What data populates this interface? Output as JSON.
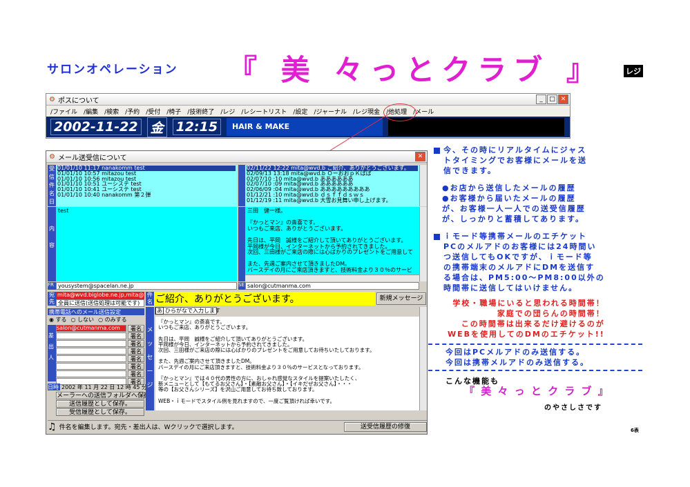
{
  "header": {
    "subtitle": "サロンオペレーション",
    "title": "『 美 々っとクラブ 』",
    "tag": "レジ"
  },
  "window_back": {
    "title": "ポスについて",
    "menu": [
      "/ファイル",
      "/編集",
      "/検索",
      "/予約",
      "/受付",
      "/椅子",
      "/技術終了",
      "/レジ",
      "/レシートリスト",
      "/設定",
      "/ジャーナル",
      "/レジ現金",
      "/他処理",
      "/メール"
    ],
    "date": "2002-11-22",
    "weekday": "金",
    "time": "12:15",
    "banner": "HAIR & MAKE"
  },
  "mail": {
    "title": "メール送受信について",
    "sent_labels": "受信件名日",
    "sent_list": [
      {
        "date": "01/01/10",
        "time": "11:17",
        "from": "nanakomm",
        "subject": "test",
        "selected": true
      },
      {
        "date": "01/01/10",
        "time": "10:57",
        "from": "mitazou",
        "subject": "test"
      },
      {
        "date": "01/01/10",
        "time": "10:56",
        "from": "mitazou",
        "subject": "test"
      },
      {
        "date": "01/01/10",
        "time": "10:51",
        "from": "ユーシステ",
        "subject": "test"
      },
      {
        "date": "01/01/10",
        "time": "10:41",
        "from": "ユーシステ",
        "subject": "test"
      },
      {
        "date": "01/01/10",
        "time": "10:40",
        "from": "nanakomm",
        "subject": "第２弾"
      }
    ],
    "recv_list": [
      {
        "date": "02/11/22",
        "time": "12:22",
        "from": "mita@wvd.b",
        "subject": "ご紹介、ありがとうございます。",
        "selected": true
      },
      {
        "date": "02/09/13",
        "time": "13:18",
        "from": "mita@wvd.b",
        "subject": "ＯーおおｐＫぱぱ"
      },
      {
        "date": "02/07/10",
        "time": ":10",
        "from": "mita@wvd.b",
        "subject": "ああああああ"
      },
      {
        "date": "02/07/10",
        "time": ":09",
        "from": "mita@wvd.b",
        "subject": "ああああああ"
      },
      {
        "date": "02/06/09",
        "time": ":04",
        "from": "mita@wvd.b",
        "subject": "あああああああああ"
      },
      {
        "date": "01/12/21",
        "time": ":10",
        "from": "mita@wvd.b",
        "subject": "ｄｓｆｆｄｓｗｓ"
      },
      {
        "date": "01/12/19",
        "time": ":11",
        "from": "mita@wvd.b",
        "subject": "大雪お見舞い申し上げます。"
      }
    ],
    "sent_body_label": "内容",
    "sent_body": "test",
    "recv_body": [
      "三田　健一様。",
      "",
      "『かっとマン』の斎喜です。",
      "いつもご来店、ありがとうございます。",
      "",
      "先日は、平岡　誠様をご紹介して頂いてありがとうございます。",
      "平岡様が今日、インターネットから予約されてきました。",
      "次回、三田様がご来店の際には心ばかりのプレゼントをご用意して",
      "",
      "また、先週ご案内させて頂きましたDM。",
      "バースデイの月にご来店頂きますと、技術料金より３０％のサービ"
    ],
    "from_label": "FR",
    "from_addr": "yousystem@spacelan.ne.jp",
    "to_label": "SE",
    "to_addr": "salon@cutmanma.com",
    "dest_label": "宛先",
    "dest_value": "mita@wvd.biglobe.ne.jp,mita@you",
    "bulk_note": "全員に送信(送信処理は可能です)",
    "mobile_title": "携帯電話へのメール送信設定",
    "mobile_opts": [
      "する",
      "しない",
      "のみする"
    ],
    "sender_label": "差出人",
    "sender_addr": "salon@cutmanma.com",
    "sign_btn": "署名",
    "datetime_label": "日時",
    "datetime": "2002 年 11 月 22 日 12 時 45 分",
    "folder_btns": [
      "メーラーへの送信フォルダへ保存。",
      "送信履歴として保存。",
      "受信履歴として保存。"
    ],
    "subject_label": "件名",
    "subject": "ご紹介、ありがとうございます。",
    "new_btn": "新規メッセージ",
    "hiragana_hint": "ひらがなで入力します",
    "input_mode": "あ",
    "msg_label": "メッセージ",
    "msg_body": [
      "『かっとマン』の斎喜です。",
      "いつもご来店、ありがとうございます。",
      "",
      "先日は、平岡　誠様をご紹介して頂いてありがとうございます。",
      "平岡様が今日、インターネットから予約されてきました。",
      "次回、三田様がご来店の際には心ばかりのプレゼントをご用意してお待ちいたしております。",
      "",
      "また、先週ご案内させて頂きましたDM。",
      "バースデイの月にご来店頂きますと、技術料金より３０％のサービスとなっております。",
      "",
      "『かっとマン』では４０代の男性の方に、おしゃれ感覚なスタイルを提案いたしたく、",
      "新メニューとして【もてるお父さん】・【素敵お父さん】・【イキだぜお父さん】・・・",
      "等の【お父さんシリーズ】を沢山ご用意してお待ち致しております。",
      "",
      "WEB・ｉモードでスタイル例を見れますので、一度ご覧頂ければ幸いです。"
    ],
    "status": "件名を編集します。宛先・差出人は、Wクリックで選択します。",
    "history_btn": "送受信履歴の修復"
  },
  "notes": {
    "p1": [
      "今、その時にリアルタイムにジャス",
      "トタイミングでお客様にメールを送",
      "信できます。"
    ],
    "p1_bullets": [
      "●お店から送信したメールの履歴",
      "●お客様から届いたメールの履歴",
      "が、お客様一人一人での送受信履歴",
      "が、しっかりと蓄積してあります。"
    ],
    "p2": [
      "ｉモード等携帯メールのエチケット",
      "PCのメルアドのお客様には24時間い",
      "つ送信してもOKですが、ｉモード等",
      "の携帯端末のメルアドにDMを送信す",
      "る場合は、PM5:00～PM8:00以外の",
      "時間帯に送信してはいけません。"
    ],
    "p3": [
      "学校・職場にいると思われる時間帯！",
      "家庭での団らんの時間帯！",
      "この時間帯は出来るだけ避けるのが",
      "WEBを使用してのDMのエチケット!!"
    ],
    "p4": [
      "今回はPCメルアドのみ送信する。",
      "今回は携帯メルアドのみ送信する。"
    ],
    "p5": "こんな機能も",
    "p5_title": "『 美 々 っ と ク ラ ブ 』",
    "p5_end": "のやさしさです",
    "page": "6表"
  }
}
